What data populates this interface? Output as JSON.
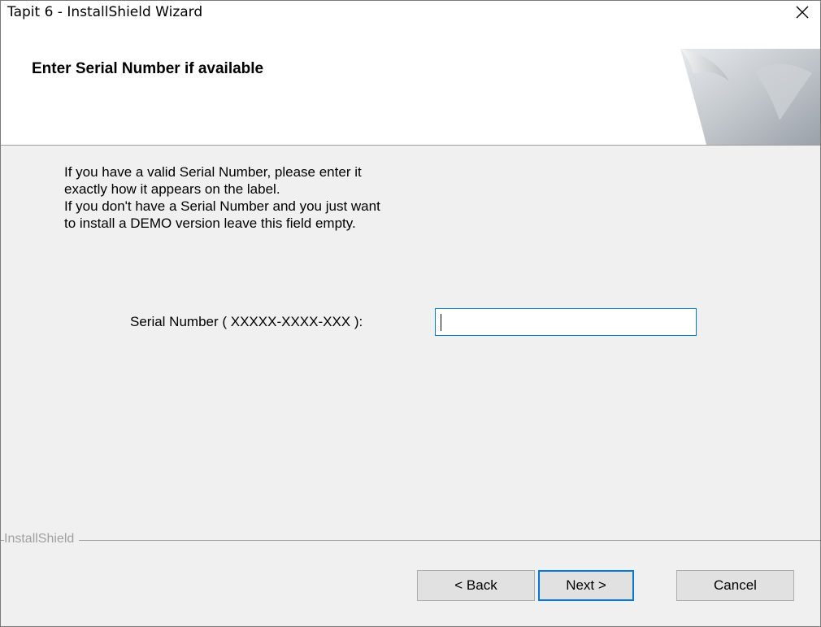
{
  "window": {
    "title": "Tapit 6 - InstallShield Wizard"
  },
  "header": {
    "title": "Enter Serial Number if available"
  },
  "body": {
    "lines": [
      "If you have a valid Serial Number, please enter it",
      "exactly how it appears on the label.",
      "If you don't have a Serial Number and you just want",
      "to install a DEMO version leave this field empty."
    ]
  },
  "serial": {
    "label": "Serial Number ( XXXXX-XXXX-XXX ):",
    "value": ""
  },
  "footer": {
    "brand": "InstallShield"
  },
  "buttons": {
    "back": "< Back",
    "next": "Next >",
    "cancel": "Cancel"
  },
  "icons": {
    "close": "close-icon",
    "header_graphic": "page-curl-graphic"
  },
  "colors": {
    "accent": "#0078d7",
    "dialog_bg": "#f0f0f0",
    "header_bg": "#ffffff",
    "brand_text": "#a0a0a0"
  }
}
